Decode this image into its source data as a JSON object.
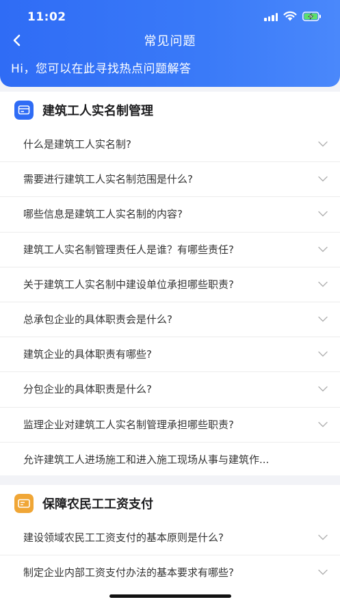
{
  "status_bar": {
    "time": "11:02"
  },
  "header": {
    "title": "常见问题",
    "subtitle": "Hi，您可以在此寻找热点问题解答"
  },
  "colors": {
    "primary": "#2f6cf5",
    "section1_icon": "#2f6cf5",
    "section2_icon": "#f0a636"
  },
  "sections": [
    {
      "icon": "card-icon",
      "title": "建筑工人实名制管理",
      "items": [
        "什么是建筑工人实名制?",
        "需要进行建筑工人实名制范围是什么?",
        "哪些信息是建筑工人实名制的内容?",
        "建筑工人实名制管理责任人是谁？有哪些责任?",
        "关于建筑工人实名制中建设单位承担哪些职责?",
        "总承包企业的具体职责会是什么?",
        "建筑企业的具体职责有哪些?",
        "分包企业的具体职责是什么?",
        "监理企业对建筑工人实名制管理承担哪些职责?",
        "允许建筑工人进场施工和进入施工现场从事与建筑作..."
      ]
    },
    {
      "icon": "id-card-icon",
      "title": "保障农民工工资支付",
      "items": [
        "建设领域农民工工资支付的基本原则是什么?",
        "制定企业内部工资支付办法的基本要求有哪些?"
      ]
    }
  ]
}
